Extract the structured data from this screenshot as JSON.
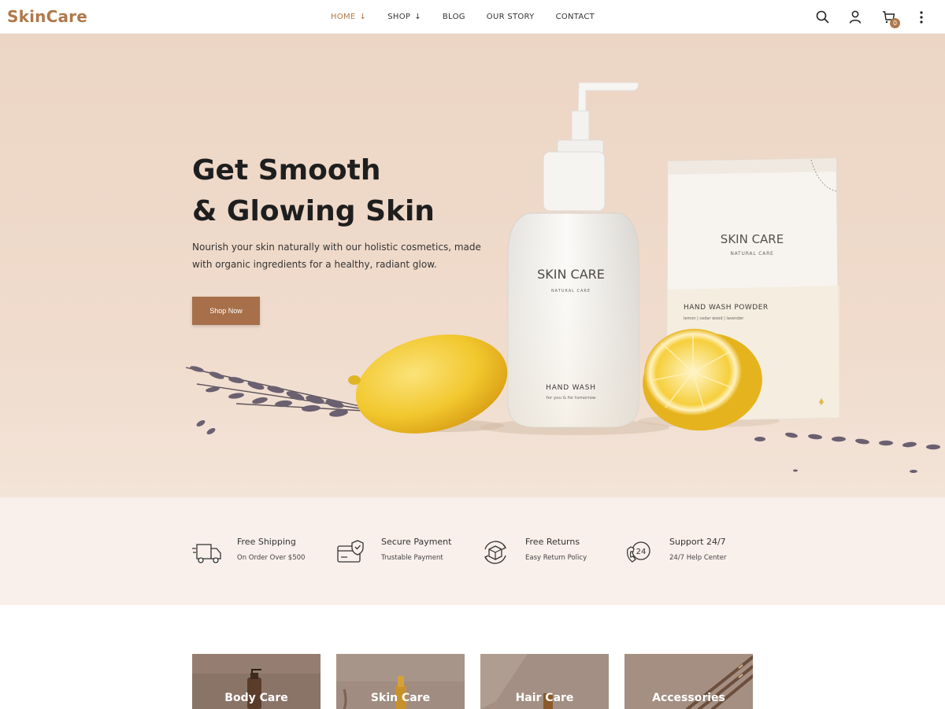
{
  "brand": {
    "logo": "SkinCare",
    "accent": "#b0784a",
    "button_color": "#a7704a"
  },
  "nav": {
    "items": [
      {
        "label": "HOME",
        "dropdown": true,
        "active": true
      },
      {
        "label": "SHOP",
        "dropdown": true,
        "active": false
      },
      {
        "label": "BLOG",
        "dropdown": false,
        "active": false
      },
      {
        "label": "OUR STORY",
        "dropdown": false,
        "active": false
      },
      {
        "label": "CONTACT",
        "dropdown": false,
        "active": false
      }
    ],
    "icons": [
      "search-icon",
      "user-icon",
      "cart-icon",
      "more-vertical-icon"
    ],
    "cart_count": "0"
  },
  "hero": {
    "title_line1": "Get Smooth",
    "title_line2": "& Glowing Skin",
    "description": "Nourish your skin naturally with our holistic cosmetics, made with organic ingredients for a healthy, radiant glow.",
    "cta": "Shop Now",
    "bottle": {
      "brand": "SKIN CARE",
      "sub": "NATURAL CARE",
      "product": "HAND WASH",
      "tagline": "for you & for tomorrow"
    },
    "pouch": {
      "brand": "SKIN CARE",
      "sub": "NATURAL CARE",
      "product": "HAND WASH POWDER",
      "ingredients": "lemon | cedar wood | lavender"
    }
  },
  "features": [
    {
      "icon": "truck-icon",
      "title": "Free Shipping",
      "subtitle": "On Order Over $500"
    },
    {
      "icon": "secure-card-icon",
      "title": "Secure Payment",
      "subtitle": "Trustable Payment"
    },
    {
      "icon": "return-box-icon",
      "title": "Free Returns",
      "subtitle": "Easy Return Policy"
    },
    {
      "icon": "support-24-icon",
      "title": "Support 24/7",
      "subtitle": "24/7 Help Center",
      "icon_text": "24"
    }
  ],
  "categories": [
    {
      "label": "Body Care"
    },
    {
      "label": "Skin Care"
    },
    {
      "label": "Hair Care"
    },
    {
      "label": "Accessories"
    }
  ]
}
